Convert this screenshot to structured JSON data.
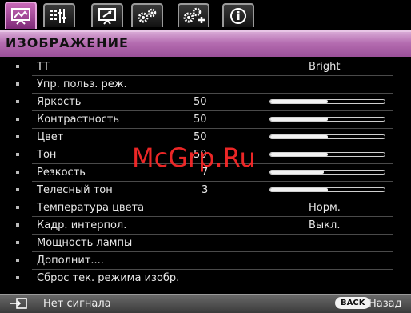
{
  "tabs": [
    {
      "icon": "picture-icon",
      "active": true
    },
    {
      "icon": "audio-settings-icon",
      "active": false
    },
    {
      "icon": "display-setup-icon",
      "active": false
    },
    {
      "icon": "gears-icon",
      "active": false
    },
    {
      "icon": "gears-plus-icon",
      "active": false
    },
    {
      "icon": "info-icon",
      "active": false
    }
  ],
  "title": "ИЗОБРАЖЕНИЕ",
  "menu": {
    "items": [
      {
        "label": "ТТ",
        "value": "Bright"
      },
      {
        "label": "Упр. польз. реж."
      },
      {
        "label": "Яркость",
        "number": "50",
        "level": 0.5
      },
      {
        "label": "Контрастность",
        "number": "50",
        "level": 0.5
      },
      {
        "label": "Цвет",
        "number": "50",
        "level": 0.5
      },
      {
        "label": "Тон",
        "number": "50",
        "level": 0.5
      },
      {
        "label": "Резкость",
        "number": "7",
        "level": 0.47
      },
      {
        "label": "Телесный тон",
        "number": "3",
        "level": 0.5
      },
      {
        "label": "Температура цвета",
        "value": "Норм."
      },
      {
        "label": "Кадр. интерпол.",
        "value": "Выкл."
      },
      {
        "label": "Мощность лампы"
      },
      {
        "label": "Дополнит...."
      },
      {
        "label": "Сброс тек. режима изобр."
      }
    ]
  },
  "footer": {
    "status": "Нет сигнала",
    "back_button": "BACK",
    "back_label": "Назад"
  },
  "watermark": "McGrp.Ru",
  "colors": {
    "accent": "#b46cb0",
    "watermark": "#ff2a2a"
  }
}
